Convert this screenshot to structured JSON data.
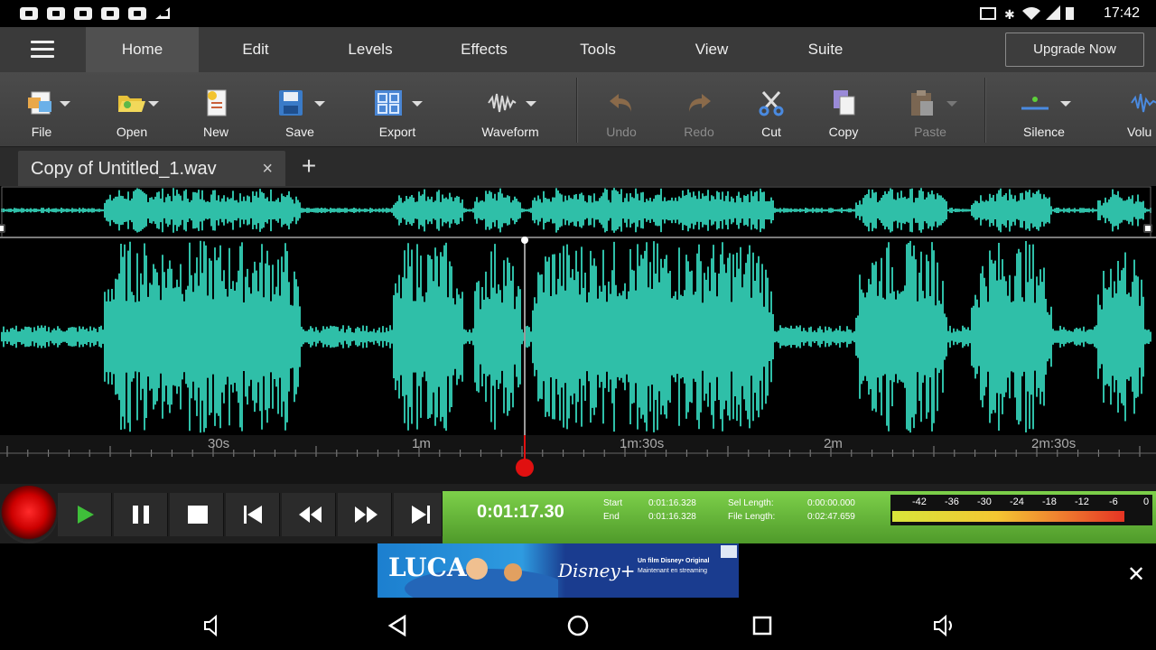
{
  "status_bar": {
    "time": "17:42",
    "icons": [
      "screenshot-icon",
      "bluetooth-icon",
      "wifi-icon",
      "signal-icon",
      "battery-icon"
    ]
  },
  "menu": {
    "tabs": [
      "Home",
      "Edit",
      "Levels",
      "Effects",
      "Tools",
      "View",
      "Suite"
    ],
    "active_tab": "Home",
    "upgrade_label": "Upgrade Now"
  },
  "toolbar": {
    "file": "File",
    "open": "Open",
    "new": "New",
    "save": "Save",
    "export": "Export",
    "waveform": "Waveform",
    "undo": "Undo",
    "redo": "Redo",
    "cut": "Cut",
    "copy": "Copy",
    "paste": "Paste",
    "silence": "Silence",
    "volume": "Volu"
  },
  "tabs": {
    "file_tab": "Copy of Untitled_1.wav",
    "close": "×",
    "add": "+"
  },
  "waveform": {
    "color": "#2fbfa8",
    "timeline_labels": [
      "30s",
      "1m",
      "1m:30s",
      "2m",
      "2m:30s"
    ],
    "playhead_fraction": 0.46
  },
  "transport": {
    "current_time": "0:01:17.30",
    "start_label": "Start",
    "start_value": "0:01:16.328",
    "end_label": "End",
    "end_value": "0:01:16.328",
    "sel_length_label": "Sel Length:",
    "sel_length_value": "0:00:00.000",
    "file_length_label": "File Length:",
    "file_length_value": "0:02:47.659",
    "meter_scale": [
      "-42",
      "-36",
      "-30",
      "-24",
      "-18",
      "-12",
      "-6",
      "0"
    ],
    "meter_level": 0.9
  },
  "ad": {
    "title": "LUCA",
    "brand": "Disney+",
    "line1": "Un film Disney• Original",
    "line2": "Maintenant en streaming",
    "close": "✕"
  },
  "colors": {
    "accent_green": "#6cc23c",
    "record_red": "#e01010",
    "waveform": "#2fbfa8"
  }
}
